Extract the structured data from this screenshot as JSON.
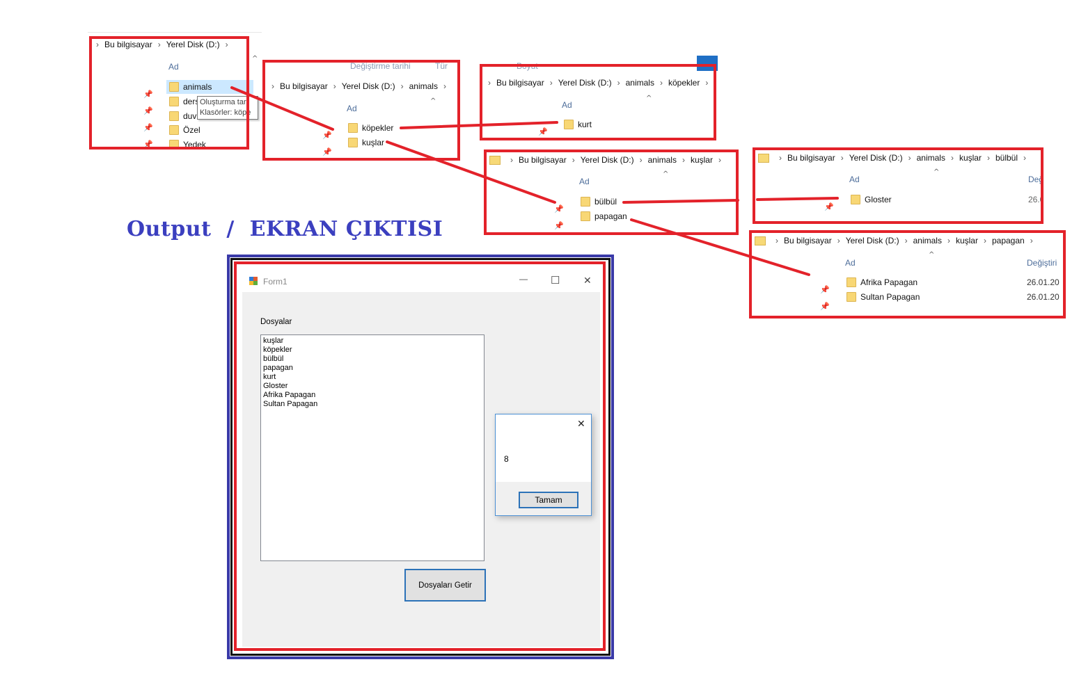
{
  "title": "Output  /  EKRAN ÇIKTISI",
  "explorers": {
    "root": {
      "breadcrumb": [
        "Bu bilgisayar",
        "Yerel Disk (D:)"
      ],
      "column_name": "Ad",
      "column_date": "Değiştirme tarihi",
      "column_type": "Tür",
      "column_size": "Boyut",
      "items": [
        "animals",
        "ders",
        "duv",
        "Özel",
        "Yedek"
      ],
      "tooltip_line1": "Oluşturma tarı",
      "tooltip_line2": "Klasörler: köpe"
    },
    "animals": {
      "breadcrumb": [
        "Bu bilgisayar",
        "Yerel Disk (D:)",
        "animals"
      ],
      "column_name": "Ad",
      "items": [
        "köpekler",
        "kuşlar"
      ]
    },
    "kopekler": {
      "breadcrumb": [
        "Bu bilgisayar",
        "Yerel Disk (D:)",
        "animals",
        "köpekler"
      ],
      "column_name": "Ad",
      "items": [
        "kurt"
      ]
    },
    "kuslar": {
      "breadcrumb": [
        "Bu bilgisayar",
        "Yerel Disk (D:)",
        "animals",
        "kuşlar"
      ],
      "column_name": "Ad",
      "items": [
        "bülbül",
        "papagan"
      ]
    },
    "bulbul": {
      "breadcrumb": [
        "Bu bilgisayar",
        "Yerel Disk (D:)",
        "animals",
        "kuşlar",
        "bülbül"
      ],
      "column_name": "Ad",
      "column_date": "Değ",
      "items": [
        "Gloster"
      ],
      "dates": [
        "26.0"
      ]
    },
    "papagan": {
      "breadcrumb": [
        "Bu bilgisayar",
        "Yerel Disk (D:)",
        "animals",
        "kuşlar",
        "papagan"
      ],
      "column_name": "Ad",
      "column_date": "Değiştiri",
      "items": [
        "Afrika Papagan",
        "Sultan Papagan"
      ],
      "dates": [
        "26.01.20",
        "26.01.20"
      ]
    }
  },
  "form": {
    "title": "Form1",
    "label": "Dosyalar",
    "list_items": [
      "kuşlar",
      "köpekler",
      "bülbül",
      "papagan",
      "kurt",
      "Gloster",
      "Afrika Papagan",
      "Sultan Papagan"
    ],
    "button_label": "Dosyaları Getir",
    "minimize": "—",
    "maximize": "☐",
    "close": "✕"
  },
  "messagebox": {
    "text": "8",
    "ok_label": "Tamam",
    "close": "✕"
  },
  "colors": {
    "highlight_box": "#e3222a",
    "title_text": "#3b3fbf",
    "frame_outer": "#3a3aa8",
    "folder": "#f8d775"
  }
}
